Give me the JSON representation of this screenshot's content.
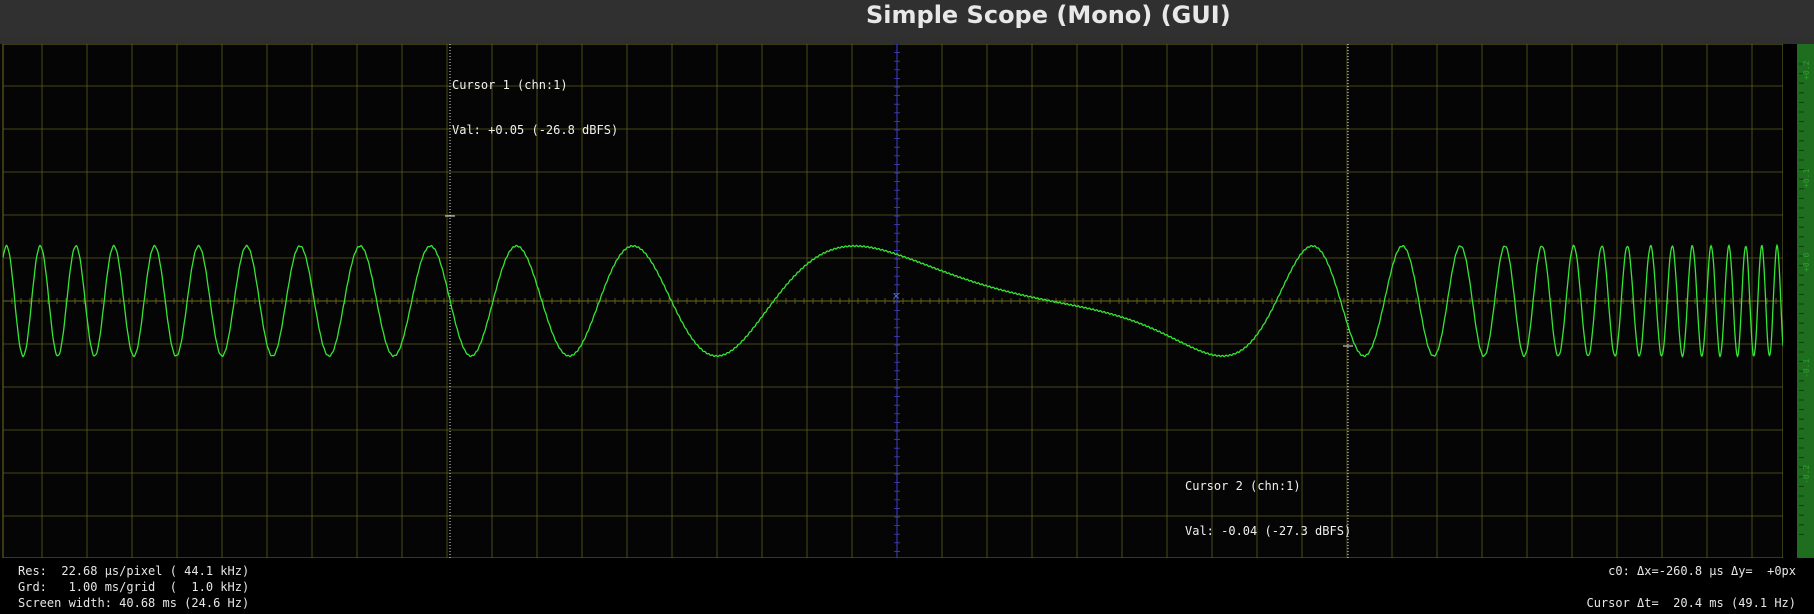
{
  "window": {
    "title": "Simple Scope (Mono) (GUI)"
  },
  "colors": {
    "background": "#050505",
    "grid": "#6b6b1f",
    "trace": "#35e535",
    "cursor": "#e6e6e6",
    "center_axis": "#4040c8",
    "level_meter": "#1f6e1f"
  },
  "cursors": {
    "cursor1": {
      "label": "Cursor 1 (chn:1)",
      "value": "Val: +0.05 (-26.8 dBFS)"
    },
    "cursor2": {
      "label": "Cursor 2 (chn:1)",
      "value": "Val: -0.04 (-27.3 dBFS)"
    }
  },
  "level_meter": {
    "scale_labels": [
      "+0.2",
      "+0.1",
      "+0.0",
      "-0.1",
      "-0.2"
    ]
  },
  "info": {
    "res": "Res:  22.68 μs/pixel ( 44.1 kHz)",
    "grd": "Grd:   1.00 ms/grid  (  1.0 kHz)",
    "screen_width": "Screen width: 40.68 ms (24.6 Hz)",
    "c0": "c0: Δx=-260.8 μs Δy=  +0px",
    "cursor_dt": "Cursor Δt=  20.4 ms (49.1 Hz)"
  },
  "trace": {
    "amplitude": 0.065,
    "description_free": true
  }
}
